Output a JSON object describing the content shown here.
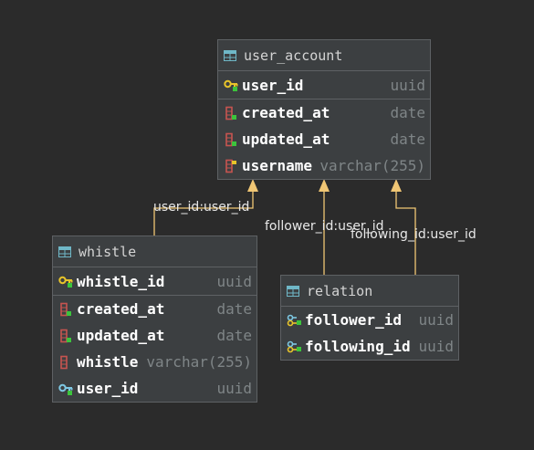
{
  "tables": {
    "user_account": {
      "name": "user_account",
      "columns": [
        {
          "name": "user_id",
          "type": "uuid",
          "icon": "primary-key-icon"
        },
        {
          "name": "created_at",
          "type": "date",
          "icon": "column-icon"
        },
        {
          "name": "updated_at",
          "type": "date",
          "icon": "column-icon"
        },
        {
          "name": "username",
          "type": "varchar(255)",
          "icon": "unique-column-icon"
        }
      ]
    },
    "whistle": {
      "name": "whistle",
      "columns": [
        {
          "name": "whistle_id",
          "type": "uuid",
          "icon": "primary-key-icon"
        },
        {
          "name": "created_at",
          "type": "date",
          "icon": "column-icon"
        },
        {
          "name": "updated_at",
          "type": "date",
          "icon": "column-icon"
        },
        {
          "name": "whistle",
          "type": "varchar(255)",
          "icon": "column-icon"
        },
        {
          "name": "user_id",
          "type": "uuid",
          "icon": "foreign-key-icon"
        }
      ]
    },
    "relation": {
      "name": "relation",
      "columns": [
        {
          "name": "follower_id",
          "type": "uuid",
          "icon": "composite-key-icon"
        },
        {
          "name": "following_id",
          "type": "uuid",
          "icon": "composite-key-icon"
        }
      ]
    }
  },
  "relationships": {
    "whistle_user": "user_id:user_id",
    "follower_user": "follower_id:user_id",
    "following_user": "following_id:user_id"
  },
  "colors": {
    "background": "#2b2b2b",
    "table_fill": "#3c3f41",
    "arrow": "#f0c674",
    "key_gold": "#e8c42a",
    "key_blue": "#7ec8e3",
    "column_red": "#c75450",
    "dot_green": "#3cc43c"
  }
}
